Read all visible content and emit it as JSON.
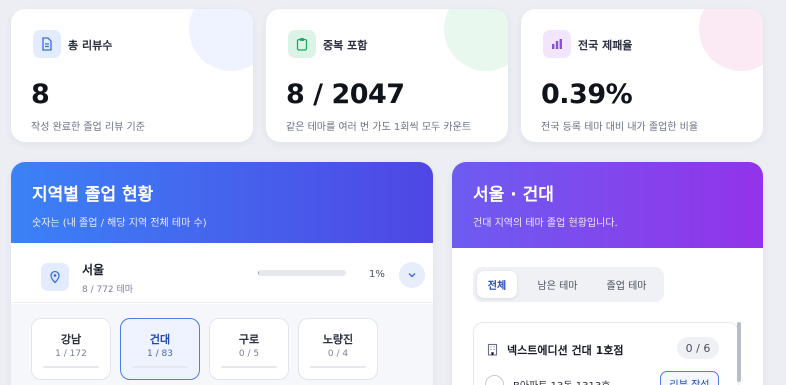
{
  "stats": [
    {
      "label": "총 리뷰수",
      "value": "8",
      "sub": "작성 완료한 졸업 리뷰 기준",
      "icon": "document-icon",
      "accent": "#3a6fe0"
    },
    {
      "label": "중복 포함",
      "value": "8 / 2047",
      "sub": "같은 테마를 여러 번 가도 1회씩 모두 카운트",
      "icon": "clipboard-icon",
      "accent": "#1ea866"
    },
    {
      "label": "전국 제패율",
      "value": "0.39%",
      "sub": "전국 등록 테마 대비 내가 졸업한 비율",
      "icon": "bar-chart-icon",
      "accent": "#8a4fd6"
    }
  ],
  "region_panel": {
    "title": "지역별 졸업 현황",
    "subtitle": "숫자는 (내 졸업 / 해당 지역 전체 테마 수)",
    "region": {
      "name": "서울",
      "count": "8 / 772 테마",
      "percent": "1%",
      "progress": 0.01
    },
    "subregions": [
      {
        "name": "강남",
        "count": "1 / 172",
        "active": false
      },
      {
        "name": "건대",
        "count": "1 / 83",
        "active": true
      },
      {
        "name": "구로",
        "count": "0 / 5",
        "active": false
      },
      {
        "name": "노량진",
        "count": "0 / 4",
        "active": false
      }
    ]
  },
  "detail_panel": {
    "title": "서울 · 건대",
    "subtitle": "건대 지역의 테마 졸업 현황입니다.",
    "tabs": [
      {
        "label": "전체",
        "active": true
      },
      {
        "label": "남은 테마",
        "active": false
      },
      {
        "label": "졸업 테마",
        "active": false
      }
    ],
    "store": {
      "name": "넥스트에디션 건대 1호점",
      "count": "0 / 6",
      "item": "B아파트 13동 1313호",
      "button": "리뷰 작성"
    }
  },
  "colors": {
    "blue_gradient": [
      "#3b82f6",
      "#4f46e5"
    ],
    "purple_gradient": [
      "#6d5cf0",
      "#9333ea"
    ]
  }
}
